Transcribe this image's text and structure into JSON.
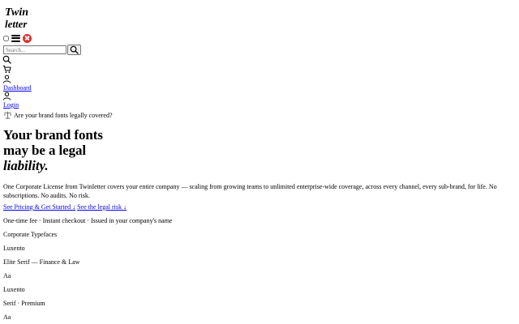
{
  "brand": {
    "logo_line1": "Twin",
    "logo_line2": "letter"
  },
  "nav": {
    "search_placeholder": "Search...",
    "dashboard_label": "Dashboard",
    "login_label": "Login"
  },
  "notice": {
    "text": "Are your brand fonts legally covered?"
  },
  "hero": {
    "line1": "Your brand fonts",
    "line2": "may be a legal",
    "line3": "liability.",
    "description": "One Corporate License from Twinletter covers your entire company — scaling from growing teams to unlimited enterprise-wide coverage, across every channel, every sub-brand, for life. No subscriptions. No audits. No risk.",
    "cta_primary": "See Pricing & Get Started ↓",
    "cta_secondary": "See the legal risk ↓",
    "meta": "One-time fee · Instant checkout · Issued in your company's name"
  },
  "typefaces": {
    "heading": "Corporate Typefaces",
    "items": [
      {
        "name": "Luxento",
        "desc": "Elite Serif — Finance & Law",
        "sample": "Aa"
      },
      {
        "name": "Luxento",
        "desc": "Serif · Premium",
        "sample": "Aa"
      }
    ]
  }
}
